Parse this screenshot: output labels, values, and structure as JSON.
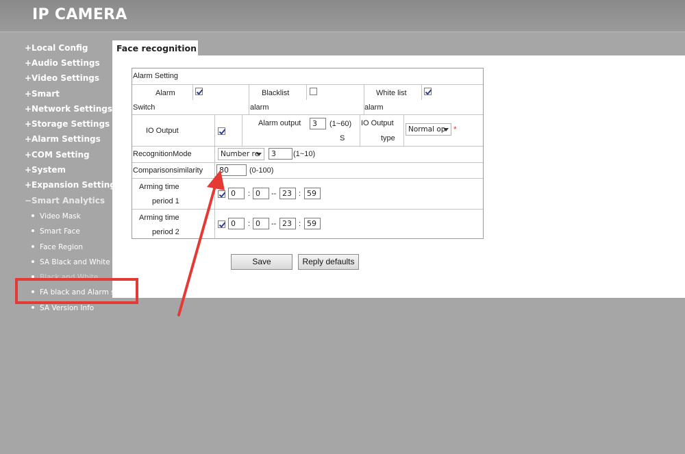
{
  "header": {
    "title": "IP CAMERA"
  },
  "sidebar": {
    "menus": [
      {
        "symbol": "+",
        "label": "Local Config"
      },
      {
        "symbol": "+",
        "label": "Audio Settings"
      },
      {
        "symbol": "+",
        "label": "Video Settings"
      },
      {
        "symbol": "+",
        "label": "Smart"
      },
      {
        "symbol": "+",
        "label": "Network Settings"
      },
      {
        "symbol": "+",
        "label": "Storage Settings"
      },
      {
        "symbol": "+",
        "label": "Alarm Settings"
      },
      {
        "symbol": "+",
        "label": "COM Setting"
      },
      {
        "symbol": "+",
        "label": "System"
      },
      {
        "symbol": "+",
        "label": "Expansion Settings"
      },
      {
        "symbol": "−",
        "label": "Smart Analytics"
      }
    ],
    "subitems": [
      {
        "label": "Video Mask"
      },
      {
        "label": "Smart Face"
      },
      {
        "label": "Face Region"
      },
      {
        "label": "SA Black and White"
      },
      {
        "label": "Black and White"
      },
      {
        "label": "FA black and Alarm se"
      },
      {
        "label": "SA Version Info"
      }
    ]
  },
  "tab": {
    "label": "Face recognition"
  },
  "form": {
    "section_title": "Alarm Setting",
    "alarm_switch": {
      "label_line1": "Alarm",
      "label_line2": "Switch",
      "checked": true
    },
    "blacklist_alarm": {
      "label_line1": "Blacklist",
      "label_line2": "alarm",
      "checked": false
    },
    "whitelist_alarm": {
      "label_line1": "White list",
      "label_line2": "alarm",
      "checked": true
    },
    "io_output": {
      "label": "IO Output",
      "checked": true
    },
    "alarm_output": {
      "label": "Alarm output",
      "value": "3",
      "range": "(1~60)",
      "unit": "S"
    },
    "io_output_type": {
      "label_line1": "IO Output",
      "label_line2": "type",
      "selected": "Normal op"
    },
    "recognition_mode": {
      "label": "RecognitionMode",
      "selected": "Number re",
      "value": "3",
      "range": "(1~10)"
    },
    "comparison_similarity": {
      "label": "Comparisonsimilarity",
      "value": "80",
      "range": "(0-100)"
    },
    "arming_period_1": {
      "label_line1": "Arming time",
      "label_line2": "period 1",
      "checked": true,
      "start_h": "0",
      "start_m": "0",
      "end_h": "23",
      "end_m": "59"
    },
    "arming_period_2": {
      "label_line1": "Arming time",
      "label_line2": "period 2",
      "checked": true,
      "start_h": "0",
      "start_m": "0",
      "end_h": "23",
      "end_m": "59"
    },
    "sep_colon": ":",
    "sep_dash": "--",
    "required_mark": "*"
  },
  "buttons": {
    "save": "Save",
    "reply_defaults": "Reply defaults"
  },
  "colors": {
    "annotation": "#e53935",
    "checkmark": "#2b3d9b"
  }
}
